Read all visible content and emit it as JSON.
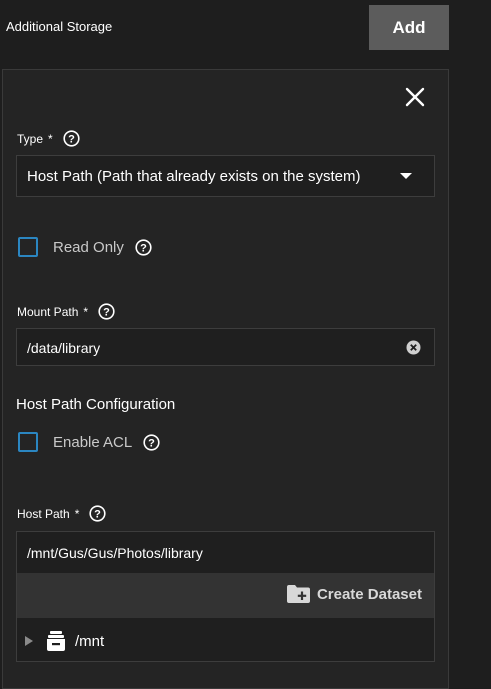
{
  "header": {
    "title": "Additional Storage",
    "add_label": "Add"
  },
  "form": {
    "type": {
      "label": "Type",
      "required_mark": "*",
      "value": "Host Path (Path that already exists on the system)"
    },
    "read_only": {
      "label": "Read Only",
      "checked": false
    },
    "mount_path": {
      "label": "Mount Path",
      "required_mark": "*",
      "value": "/data/library"
    },
    "host_path_config": {
      "heading": "Host Path Configuration"
    },
    "enable_acl": {
      "label": "Enable ACL",
      "checked": false
    },
    "host_path": {
      "label": "Host Path",
      "required_mark": "*",
      "value": "/mnt/Gus/Gus/Photos/library",
      "create_dataset_label": "Create Dataset",
      "tree": [
        {
          "label": "/mnt",
          "icon": "dataset-icon",
          "expanded": false
        }
      ]
    }
  },
  "colors": {
    "background": "#1e1e1e",
    "panel": "#242424",
    "add_button": "#5c5c5c",
    "checkbox_border": "#2b86c1",
    "toolbar": "#333333"
  }
}
